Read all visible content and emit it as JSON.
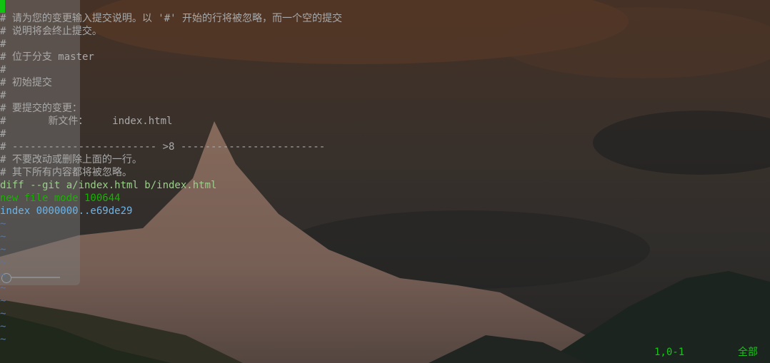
{
  "editor": {
    "lines": [
      {
        "text": "# 请为您的变更输入提交说明。以 '#' 开始的行将被忽略，而一个空的提交",
        "kind": "comment"
      },
      {
        "text": "# 说明将会终止提交。",
        "kind": "comment"
      },
      {
        "text": "#",
        "kind": "comment"
      },
      {
        "text": "# 位于分支 master",
        "kind": "comment"
      },
      {
        "text": "#",
        "kind": "comment"
      },
      {
        "text": "# 初始提交",
        "kind": "comment"
      },
      {
        "text": "#",
        "kind": "comment"
      },
      {
        "text": "# 要提交的变更：",
        "kind": "comment"
      },
      {
        "text": "#       新文件：    index.html",
        "kind": "comment"
      },
      {
        "text": "#",
        "kind": "comment"
      },
      {
        "text": "# ------------------------ >8 ------------------------",
        "kind": "comment"
      },
      {
        "text": "# 不要改动或删除上面的一行。",
        "kind": "comment"
      },
      {
        "text": "# 其下所有内容都将被忽略。",
        "kind": "comment"
      },
      {
        "text": "diff --git a/index.html b/index.html",
        "kind": "diff-head"
      },
      {
        "text": "new file mode 100644",
        "kind": "diff-new"
      },
      {
        "text": "index 0000000..e69de29",
        "kind": "diff-index"
      }
    ],
    "tilde_lines": [
      "~",
      "~",
      "~",
      "~",
      "~",
      "~",
      "~",
      "~",
      "~",
      "~"
    ]
  },
  "status": {
    "position": "1,0-1",
    "scroll": "全部"
  },
  "colors": {
    "comment": "#a9a9a9",
    "diff_head": "#9bd08a",
    "diff_new": "#18b300",
    "diff_index": "#6cb4e8",
    "tilde": "#3a7bd5",
    "status": "#19c419",
    "cursor": "#11c411"
  }
}
